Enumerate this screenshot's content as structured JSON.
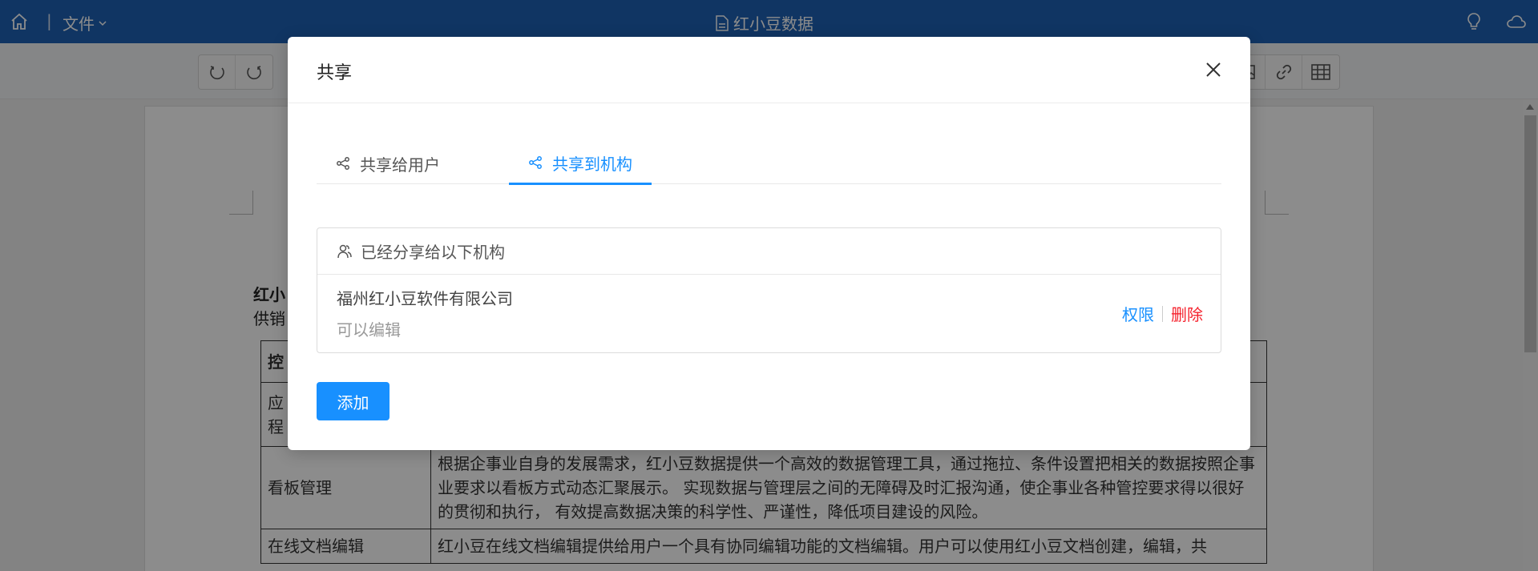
{
  "topbar": {
    "file_menu": "文件",
    "doc_title": "红小豆数据"
  },
  "document": {
    "intro_line1_bold": "红小",
    "intro_line2": "供销",
    "rows": [
      {
        "c1": "控",
        "c2": ""
      },
      {
        "c1": "应\n程",
        "c2": ""
      },
      {
        "c1": "看板管理",
        "c2": "根据企事业自身的发展需求，红小豆数据提供一个高效的数据管理工具，通过拖拉、条件设置把相关的数据按照企事业要求以看板方式动态汇聚展示。 实现数据与管理层之间的无障碍及时汇报沟通，使企事业各种管控要求得以很好的贯彻和执行， 有效提高数据决策的科学性、严谨性，降低项目建设的风险。"
      },
      {
        "c1": "在线文档编辑",
        "c2": "红小豆在线文档编辑提供给用户一个具有协同编辑功能的文档编辑。用户可以使用红小豆文档创建，编辑，共"
      }
    ]
  },
  "modal": {
    "title": "共享",
    "tabs": [
      {
        "label": "共享给用户",
        "active": false
      },
      {
        "label": "共享到机构",
        "active": true
      }
    ],
    "panel_header": "已经分享给以下机构",
    "org": {
      "name": "福州红小豆软件有限公司",
      "permission": "可以编辑",
      "action_perm": "权限",
      "action_delete": "删除"
    },
    "add_button": "添加"
  },
  "colors": {
    "topbar": "#1e62b4",
    "accent": "#1890ff",
    "danger": "#f5222d"
  }
}
